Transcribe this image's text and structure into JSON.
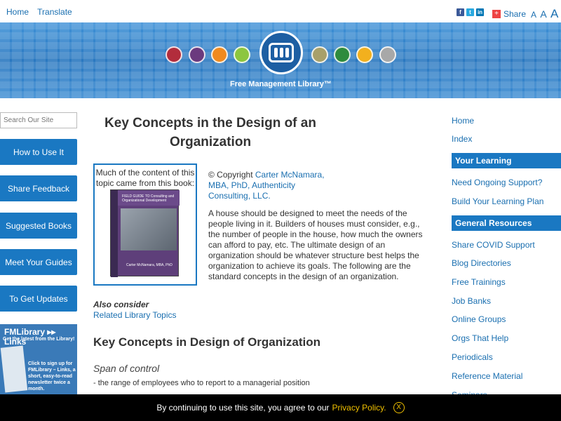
{
  "topnav": {
    "home": "Home",
    "translate": "Translate"
  },
  "social": {
    "facebook": "f",
    "twitter": "t",
    "linkedin": "in",
    "share_label": "Share",
    "share_icon": "+"
  },
  "fontsizes": [
    "A",
    "A",
    "A"
  ],
  "banner": {
    "logo_text": "Free Management Library™",
    "dots": [
      "#b22d3c",
      "#6b3a7e",
      "#f08a1f",
      "#8cc63f",
      "#a8a06a",
      "#2e8b3d",
      "#f2b01e",
      "#a8a8a8"
    ]
  },
  "sidebar": {
    "search_placeholder": "Search Our Site",
    "buttons": [
      "How to Use It",
      "Share Feedback",
      "Suggested Books",
      "Meet Your Guides",
      "To Get Updates"
    ],
    "promo": {
      "title": "FMLibrary ▸▸ Links",
      "subtitle": "Get the latest from the Library!",
      "text": "Click to sign up for FMLibrary – Links, a short, easy-to-read newsletter twice a month."
    }
  },
  "main": {
    "title": "Key Concepts in the Design of an Organization",
    "book_text": "Much of the content of this topic came from this book:",
    "book_cover": {
      "title": "FIELD GUIDE TO Consulting and Organizational Development",
      "author": "Carter McNamara, MBA, PhD"
    },
    "copyright_prefix": "© Copyright ",
    "copyright_link": "Carter McNamara, MBA, PhD, Authenticity Consulting, LLC.",
    "intro": "A house should be designed to meet the needs of the people living in it. Builders of houses must consider, e.g., the number of people in the house, how much the owners can afford to pay, etc. The ultimate design of an organization should be whatever structure best helps the organization to achieve its goals. The following are the standard concepts in the design of an organization.",
    "also_consider": "Also consider",
    "related": "Related Library Topics",
    "h2": "Key Concepts in Design of Organization",
    "span_title": "Span of control",
    "span_def": "- the range of employees who to report to a managerial position"
  },
  "right": {
    "links_top": [
      "Home",
      "Index"
    ],
    "head_learning": "Your Learning",
    "learning_links": [
      "Need Ongoing Support?",
      "Build Your Learning Plan"
    ],
    "head_general": "General Resources",
    "general_links": [
      "Share COVID Support",
      "Blog Directories",
      "Free Trainings",
      "Job Banks",
      "Online Groups",
      "Orgs That Help",
      "Periodicals",
      "Reference Material",
      "Seminars"
    ]
  },
  "cookie": {
    "text": "By continuing to use this site, you agree to our",
    "link": "Privacy Policy.",
    "close": "X"
  }
}
